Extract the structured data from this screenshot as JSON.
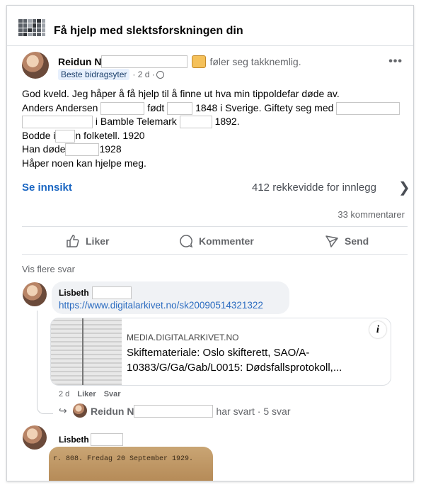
{
  "group": {
    "title": "Få hjelp med slektsforskningen din",
    "icon": "group-grid-icon"
  },
  "post": {
    "author": "Reidun N",
    "feeling": "føler seg takknemlig.",
    "badge": "Beste bidragsyter",
    "time": "· 2 d ·",
    "more": "•••",
    "lines": {
      "l1": "God kveld. Jeg håper å få hjelp til å finne ut hva min tippoldefar døde av.",
      "l2a": "Anders Andersen",
      "l2b": "født",
      "l2c": "1848 i Sverige. Giftety seg med",
      "l3a": "i Bamble Telemark",
      "l3b": "1892.",
      "l4a": "Bodde i",
      "l4b": "n folketell. 1920",
      "l5a": "Han døde",
      "l5b": "1928",
      "l6": "Håper noen kan hjelpe meg."
    },
    "insight": "Se innsikt",
    "reach": "412 rekkevidde for innlegg",
    "comments_count": "33 kommentarer"
  },
  "actions": {
    "like": "Liker",
    "comment": "Kommenter",
    "send": "Send"
  },
  "more_replies": "Vis flere svar",
  "comment1": {
    "author": "Lisbeth",
    "link": "https://www.digitalarkivet.no/sk20090514321322",
    "card": {
      "domain": "MEDIA.DIGITALARKIVET.NO",
      "title": "Skiftemateriale: Oslo skifterett, SAO/A-10383/G/Ga/Gab/L0015: Dødsfallsprotokoll,..."
    },
    "time": "2 d",
    "like": "Liker",
    "reply": "Svar",
    "reply_summary": {
      "author": "Reidun N",
      "text": "har svart · 5 svar"
    }
  },
  "comment2": {
    "author": "Lisbeth",
    "scan_text": "r. 808.  Fredag 20 September 1929."
  }
}
